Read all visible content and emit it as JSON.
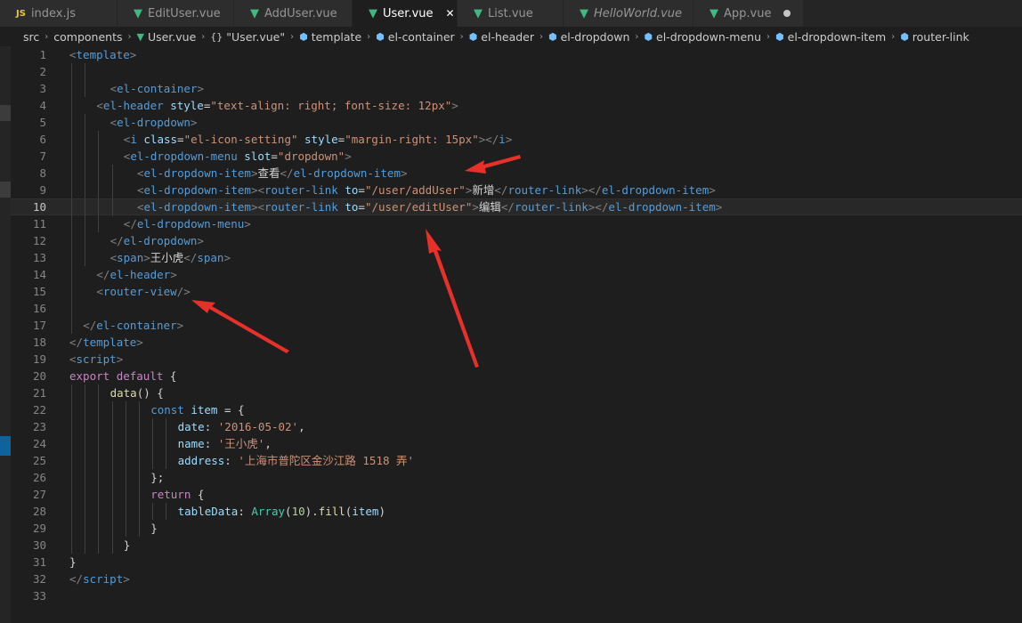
{
  "tabs": [
    {
      "label": "index.js",
      "icon": "js-file-icon",
      "icon_text": "JS",
      "active": false
    },
    {
      "label": "EditUser.vue",
      "icon": "vue-file-icon",
      "active": false
    },
    {
      "label": "AddUser.vue",
      "icon": "vue-file-icon",
      "active": false
    },
    {
      "label": "User.vue",
      "icon": "vue-file-icon",
      "active": true,
      "close": "✕"
    },
    {
      "label": "List.vue",
      "icon": "vue-file-icon",
      "active": false
    },
    {
      "label": "HelloWorld.vue",
      "icon": "vue-file-icon",
      "active": false,
      "italic": true
    },
    {
      "label": "App.vue",
      "icon": "vue-file-icon",
      "active": false,
      "dirty": true
    }
  ],
  "breadcrumb": [
    {
      "label": "src",
      "icon": ""
    },
    {
      "label": "components",
      "icon": ""
    },
    {
      "label": "User.vue",
      "icon": "vue"
    },
    {
      "label": "\"User.vue\"",
      "icon": "braces",
      "icon_text": "{}"
    },
    {
      "label": "template",
      "icon": "cube"
    },
    {
      "label": "el-container",
      "icon": "cube"
    },
    {
      "label": "el-header",
      "icon": "cube"
    },
    {
      "label": "el-dropdown",
      "icon": "cube"
    },
    {
      "label": "el-dropdown-menu",
      "icon": "cube"
    },
    {
      "label": "el-dropdown-item",
      "icon": "cube"
    },
    {
      "label": "router-link",
      "icon": "cube"
    }
  ],
  "current_line": 10,
  "lines": [
    {
      "n": "1",
      "guides": 0,
      "tokens": [
        [
          "punc",
          "<"
        ],
        [
          "tag",
          "template"
        ],
        [
          "punc",
          ">"
        ]
      ]
    },
    {
      "n": "2",
      "guides": 2,
      "tokens": []
    },
    {
      "n": "3",
      "guides": 2,
      "tokens": [
        [
          "punc",
          "<"
        ],
        [
          "tag",
          "el-container"
        ],
        [
          "punc",
          ">"
        ]
      ]
    },
    {
      "n": "4",
      "guides": 1,
      "tokens": [
        [
          "punc",
          "<"
        ],
        [
          "tag",
          "el-header"
        ],
        [
          "text",
          " "
        ],
        [
          "attr",
          "style"
        ],
        [
          "text",
          "="
        ],
        [
          "str",
          "\"text-align: right; font-size: 12px\""
        ],
        [
          "punc",
          ">"
        ]
      ]
    },
    {
      "n": "5",
      "guides": 2,
      "tokens": [
        [
          "punc",
          "<"
        ],
        [
          "tag",
          "el-dropdown"
        ],
        [
          "punc",
          ">"
        ]
      ]
    },
    {
      "n": "6",
      "guides": 3,
      "tokens": [
        [
          "punc",
          "<"
        ],
        [
          "tag",
          "i"
        ],
        [
          "text",
          " "
        ],
        [
          "attr",
          "class"
        ],
        [
          "text",
          "="
        ],
        [
          "str",
          "\"el-icon-setting\""
        ],
        [
          "text",
          " "
        ],
        [
          "attr",
          "style"
        ],
        [
          "text",
          "="
        ],
        [
          "str",
          "\"margin-right: 15px\""
        ],
        [
          "punc",
          "></"
        ],
        [
          "tag",
          "i"
        ],
        [
          "punc",
          ">"
        ]
      ]
    },
    {
      "n": "7",
      "guides": 3,
      "tokens": [
        [
          "punc",
          "<"
        ],
        [
          "tag",
          "el-dropdown-menu"
        ],
        [
          "text",
          " "
        ],
        [
          "attr",
          "slot"
        ],
        [
          "text",
          "="
        ],
        [
          "str",
          "\"dropdown\""
        ],
        [
          "punc",
          ">"
        ]
      ]
    },
    {
      "n": "8",
      "guides": 4,
      "tokens": [
        [
          "punc",
          "<"
        ],
        [
          "tag",
          "el-dropdown-item"
        ],
        [
          "punc",
          ">"
        ],
        [
          "text",
          "查看"
        ],
        [
          "punc",
          "</"
        ],
        [
          "tag",
          "el-dropdown-item"
        ],
        [
          "punc",
          ">"
        ]
      ]
    },
    {
      "n": "9",
      "guides": 4,
      "tokens": [
        [
          "punc",
          "<"
        ],
        [
          "tag",
          "el-dropdown-item"
        ],
        [
          "punc",
          "><"
        ],
        [
          "tag",
          "router-link"
        ],
        [
          "text",
          " "
        ],
        [
          "attr",
          "to"
        ],
        [
          "text",
          "="
        ],
        [
          "str",
          "\"/user/addUser\""
        ],
        [
          "punc",
          ">"
        ],
        [
          "text",
          "新增"
        ],
        [
          "punc",
          "</"
        ],
        [
          "tag",
          "router-link"
        ],
        [
          "punc",
          "></"
        ],
        [
          "tag",
          "el-dropdown-item"
        ],
        [
          "punc",
          ">"
        ]
      ]
    },
    {
      "n": "10",
      "guides": 4,
      "tokens": [
        [
          "punc",
          "<"
        ],
        [
          "tag",
          "el-dropdown-item"
        ],
        [
          "punc",
          "><"
        ],
        [
          "tag",
          "router-link"
        ],
        [
          "text",
          " "
        ],
        [
          "attr",
          "to"
        ],
        [
          "text",
          "="
        ],
        [
          "str",
          "\"/user/editUser\""
        ],
        [
          "punc",
          ">"
        ],
        [
          "text",
          "编辑"
        ],
        [
          "punc",
          "</"
        ],
        [
          "tag",
          "router-link"
        ],
        [
          "punc",
          "></"
        ],
        [
          "tag",
          "el-dropdown-item"
        ],
        [
          "punc",
          ">"
        ]
      ]
    },
    {
      "n": "11",
      "guides": 3,
      "tokens": [
        [
          "punc",
          "</"
        ],
        [
          "tag",
          "el-dropdown-menu"
        ],
        [
          "punc",
          ">"
        ]
      ]
    },
    {
      "n": "12",
      "guides": 2,
      "tokens": [
        [
          "punc",
          "</"
        ],
        [
          "tag",
          "el-dropdown"
        ],
        [
          "punc",
          ">"
        ]
      ]
    },
    {
      "n": "13",
      "guides": 2,
      "tokens": [
        [
          "punc",
          "<"
        ],
        [
          "tag",
          "span"
        ],
        [
          "punc",
          ">"
        ],
        [
          "text",
          "王小虎"
        ],
        [
          "punc",
          "</"
        ],
        [
          "tag",
          "span"
        ],
        [
          "punc",
          ">"
        ]
      ]
    },
    {
      "n": "14",
      "guides": 1,
      "tokens": [
        [
          "punc",
          "</"
        ],
        [
          "tag",
          "el-header"
        ],
        [
          "punc",
          ">"
        ]
      ]
    },
    {
      "n": "15",
      "guides": 1,
      "tokens": [
        [
          "punc",
          "<"
        ],
        [
          "tag",
          "router-view"
        ],
        [
          "punc",
          "/>"
        ]
      ]
    },
    {
      "n": "16",
      "guides": 1,
      "tokens": []
    },
    {
      "n": "17",
      "guides": 1,
      "tokens": [
        [
          "punc",
          "</"
        ],
        [
          "tag",
          "el-container"
        ],
        [
          "punc",
          ">"
        ]
      ]
    },
    {
      "n": "18",
      "guides": 0,
      "tokens": [
        [
          "punc",
          "</"
        ],
        [
          "tag",
          "template"
        ],
        [
          "punc",
          ">"
        ]
      ]
    },
    {
      "n": "19",
      "guides": 0,
      "tokens": [
        [
          "punc",
          "<"
        ],
        [
          "tag",
          "script"
        ],
        [
          "punc",
          ">"
        ]
      ]
    },
    {
      "n": "20",
      "guides": 0,
      "tokens": [
        [
          "kw",
          "export"
        ],
        [
          "text",
          " "
        ],
        [
          "kw",
          "default"
        ],
        [
          "text",
          " {"
        ]
      ]
    },
    {
      "n": "21",
      "guides": 3,
      "tokens": [
        [
          "fn",
          "data"
        ],
        [
          "text",
          "() {"
        ]
      ]
    },
    {
      "n": "22",
      "guides": 6,
      "tokens": [
        [
          "kw2",
          "const"
        ],
        [
          "text",
          " "
        ],
        [
          "prop",
          "item"
        ],
        [
          "text",
          " = {"
        ]
      ]
    },
    {
      "n": "23",
      "guides": 8,
      "tokens": [
        [
          "prop",
          "date"
        ],
        [
          "text",
          ": "
        ],
        [
          "str",
          "'2016-05-02'"
        ],
        [
          "text",
          ","
        ]
      ]
    },
    {
      "n": "24",
      "guides": 8,
      "tokens": [
        [
          "prop",
          "name"
        ],
        [
          "text",
          ": "
        ],
        [
          "str",
          "'王小虎'"
        ],
        [
          "text",
          ","
        ]
      ]
    },
    {
      "n": "25",
      "guides": 8,
      "tokens": [
        [
          "prop",
          "address"
        ],
        [
          "text",
          ": "
        ],
        [
          "str",
          "'上海市普陀区金沙江路 1518 弄'"
        ]
      ]
    },
    {
      "n": "26",
      "guides": 6,
      "tokens": [
        [
          "text",
          "};"
        ]
      ]
    },
    {
      "n": "27",
      "guides": 6,
      "tokens": [
        [
          "kw",
          "return"
        ],
        [
          "text",
          " {"
        ]
      ]
    },
    {
      "n": "28",
      "guides": 8,
      "tokens": [
        [
          "prop",
          "tableData"
        ],
        [
          "text",
          ": "
        ],
        [
          "cls",
          "Array"
        ],
        [
          "text",
          "("
        ],
        [
          "num",
          "10"
        ],
        [
          "text",
          ")."
        ],
        [
          "fn",
          "fill"
        ],
        [
          "text",
          "("
        ],
        [
          "prop",
          "item"
        ],
        [
          "text",
          ")"
        ]
      ]
    },
    {
      "n": "29",
      "guides": 6,
      "tokens": [
        [
          "text",
          "}"
        ]
      ]
    },
    {
      "n": "30",
      "guides": 4,
      "tokens": [
        [
          "text",
          "}"
        ]
      ]
    },
    {
      "n": "31",
      "guides": 0,
      "tokens": [
        [
          "text",
          "}"
        ]
      ]
    },
    {
      "n": "32",
      "guides": 0,
      "tokens": [
        [
          "punc",
          "</"
        ],
        [
          "tag",
          "script"
        ],
        [
          "punc",
          ">"
        ]
      ]
    },
    {
      "n": "33",
      "guides": 0,
      "tokens": []
    }
  ],
  "code_indent_cols": {
    "3": 6,
    "4": 4,
    "5": 6,
    "6": 8,
    "7": 8,
    "8": 10,
    "9": 10,
    "10": 10,
    "11": 8,
    "12": 6,
    "13": 6,
    "14": 4,
    "15": 4,
    "17": 2,
    "21": 6,
    "22": 12,
    "23": 16,
    "24": 16,
    "25": 16,
    "26": 12,
    "27": 12,
    "28": 16,
    "29": 12,
    "30": 8
  },
  "colors": {
    "annotation_arrow": "#e8302a",
    "background": "#1e1e1e",
    "vue_green": "#41b883"
  }
}
